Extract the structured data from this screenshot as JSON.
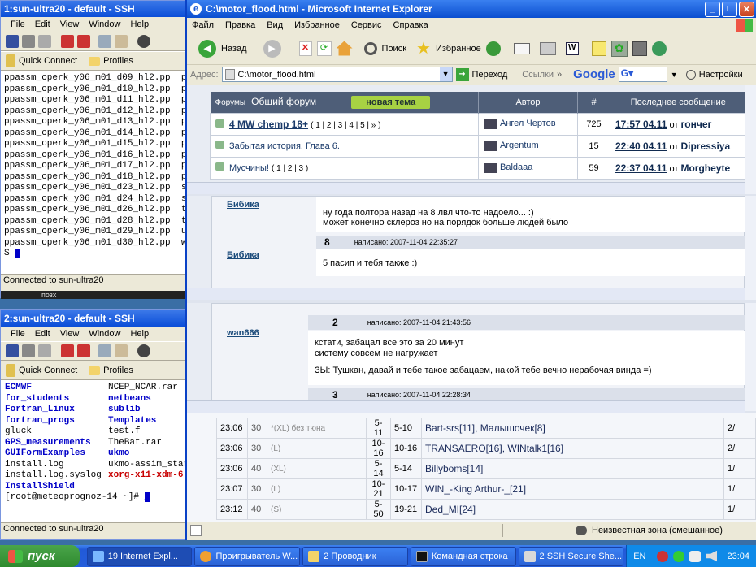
{
  "ssh1": {
    "title": "1:sun-ultra20 - default - SSH",
    "menu": [
      "File",
      "Edit",
      "View",
      "Window",
      "Help"
    ],
    "quick_connect": "Quick Connect",
    "profiles": "Profiles",
    "lines": [
      "ppassm_operk_y06_m01_d09_hl2.pp  p",
      "ppassm_operk_y06_m01_d10_hl2.pp  p",
      "ppassm_operk_y06_m01_d11_hl2.pp  p",
      "ppassm_operk_y06_m01_d12_hl2.pp  p",
      "ppassm_operk_y06_m01_d13_hl2.pp  p",
      "ppassm_operk_y06_m01_d14_hl2.pp  p",
      "ppassm_operk_y06_m01_d15_hl2.pp  p",
      "ppassm_operk_y06_m01_d16_hl2.pp  p",
      "ppassm_operk_y06_m01_d17_hl2.pp  p",
      "ppassm_operk_y06_m01_d18_hl2.pp  p",
      "ppassm_operk_y06_m01_d23_hl2.pp  s",
      "ppassm_operk_y06_m01_d24_hl2.pp  s",
      "ppassm_operk_y06_m01_d26_hl2.pp  t",
      "ppassm_operk_y06_m01_d28_hl2.pp  t",
      "ppassm_operk_y06_m01_d29_hl2.pp  u",
      "ppassm_operk_y06_m01_d30_hl2.pp  w"
    ],
    "prompt": "$ ",
    "status": "Connected to sun-ultra20",
    "hidden": "позх"
  },
  "ssh2": {
    "title": "2:sun-ultra20 - default - SSH",
    "menu": [
      "File",
      "Edit",
      "View",
      "Window",
      "Help"
    ],
    "quick_connect": "Quick Connect",
    "profiles": "Profiles",
    "left": [
      {
        "t": "ECMWF",
        "c": "#0000c8",
        "b": true
      },
      {
        "t": "for_students",
        "c": "#0000c8",
        "b": true
      },
      {
        "t": "Fortran_Linux",
        "c": "#0000c8",
        "b": true
      },
      {
        "t": "fortran_progs",
        "c": "#0000c8",
        "b": true
      },
      {
        "t": "gluck",
        "c": "#000",
        "b": false
      },
      {
        "t": "GPS_measurements",
        "c": "#0000c8",
        "b": true
      },
      {
        "t": "GUIFormExamples",
        "c": "#0000c8",
        "b": true
      },
      {
        "t": "install.log",
        "c": "#000",
        "b": false
      },
      {
        "t": "install.log.syslog",
        "c": "#000",
        "b": false
      },
      {
        "t": "InstallShield",
        "c": "#0000c8",
        "b": true
      }
    ],
    "right": [
      {
        "t": "NCEP_NCAR.rar",
        "c": "#000",
        "b": false
      },
      {
        "t": "netbeans",
        "c": "#0000c8",
        "b": true
      },
      {
        "t": "sublib",
        "c": "#0000c8",
        "b": true
      },
      {
        "t": "Templates",
        "c": "#0000c8",
        "b": true
      },
      {
        "t": "test.f",
        "c": "#000",
        "b": false
      },
      {
        "t": "TheBat.rar",
        "c": "#000",
        "b": false
      },
      {
        "t": "ukmo",
        "c": "#0000c8",
        "b": true
      },
      {
        "t": "ukmo-assim_star",
        "c": "#000",
        "b": false
      },
      {
        "t": "xorg-x11-xdm-6.",
        "c": "#c80000",
        "b": true
      },
      {
        "t": "",
        "c": "#000",
        "b": false
      }
    ],
    "prompt": "[root@meteoprognoz-14 ~]# ",
    "status": "Connected to sun-ultra20"
  },
  "ie": {
    "title": "C:\\motor_flood.html - Microsoft Internet Explorer",
    "menu": [
      "Файл",
      "Правка",
      "Вид",
      "Избранное",
      "Сервис",
      "Справка"
    ],
    "back": "Назад",
    "search": "Поиск",
    "favorites": "Избранное",
    "address_label": "Адрес:",
    "address": "C:\\motor_flood.html",
    "go": "Переход",
    "links": "Ссылки",
    "google": "Google",
    "settings": "Настройки",
    "status_zone": "Неизвестная зона (смешанное)"
  },
  "forum": {
    "crumb": "Форумы",
    "title": "Общий форум",
    "new_topic": "новая тема",
    "col_author": "Автор",
    "col_num": "#",
    "col_last": "Последнее сообщение",
    "rows": [
      {
        "title": "4 MW chemp 18+",
        "pages": "( 1 | 2 | 3 | 4 | 5 | » )",
        "author": "Ангел Чертов",
        "count": "725",
        "time": "17:57 04.11",
        "from": "от",
        "user": "гончег"
      },
      {
        "title": "Забытая история. Глава 6.",
        "pages": "",
        "author": "Argentum",
        "count": "15",
        "time": "22:40 04.11",
        "from": "от",
        "user": "Dipressiya"
      },
      {
        "title": "Мусчины!",
        "pages": "( 1 | 2 | 3 )",
        "author": "Baldaaa",
        "count": "59",
        "time": "22:37 04.11",
        "from": "от",
        "user": "Morgheyte"
      }
    ]
  },
  "posts1": {
    "user1": "Бибика",
    "text1a": "ну года полтора назад на 8 лвл что-то надоело... :)",
    "text1b": "может конечно склероз но на порядок больше людей было",
    "num": "8",
    "date": "написано: 2007-11-04 22:35:27",
    "user2": "Бибика",
    "text2": "5 пасип и тебя также :)"
  },
  "posts2": {
    "user": "wan666",
    "num": "2",
    "date": "написано: 2007-11-04 21:43:56",
    "l1": "кстати, забацал все это за 20 минут",
    "l2": "систему совсем не нагружает",
    "l3": "ЗЫ: Тушкан, давай и тебе такое забацаем, накой тебе вечно нерабочая винда =)",
    "num2": "3",
    "date2": "написано: 2007-11-04 22:28:34"
  },
  "games": [
    {
      "time": "23:06",
      "n": "30",
      "type": "*(XL) без тюна",
      "lv": "5-11",
      "lv2": "5-10",
      "players": "Bart-srs[11], Малышочек[8]",
      "end": "2/"
    },
    {
      "time": "23:06",
      "n": "30",
      "type": "(L)",
      "lv": "10-16",
      "lv2": "10-16",
      "players": "TRANSAERO[16], WINtalk1[16]",
      "end": "2/"
    },
    {
      "time": "23:06",
      "n": "40",
      "type": "(XL)",
      "lv": "5-14",
      "lv2": "5-14",
      "players": "Billyboms[14]",
      "end": "1/"
    },
    {
      "time": "23:07",
      "n": "30",
      "type": "(L)",
      "lv": "10-21",
      "lv2": "10-17",
      "players": "WIN_-King Arthur-_[21]",
      "end": "1/"
    },
    {
      "time": "23:12",
      "n": "40",
      "type": "(S)",
      "lv": "5-50",
      "lv2": "19-21",
      "players": "Ded_MI[24]",
      "end": "1/"
    }
  ],
  "taskbar": {
    "start": "пуск",
    "items": [
      "19 Internet Expl...",
      "Проигрыватель W...",
      "2 Проводник",
      "Командная строка",
      "2 SSH Secure She..."
    ],
    "lang": "EN",
    "clock": "23:04"
  }
}
